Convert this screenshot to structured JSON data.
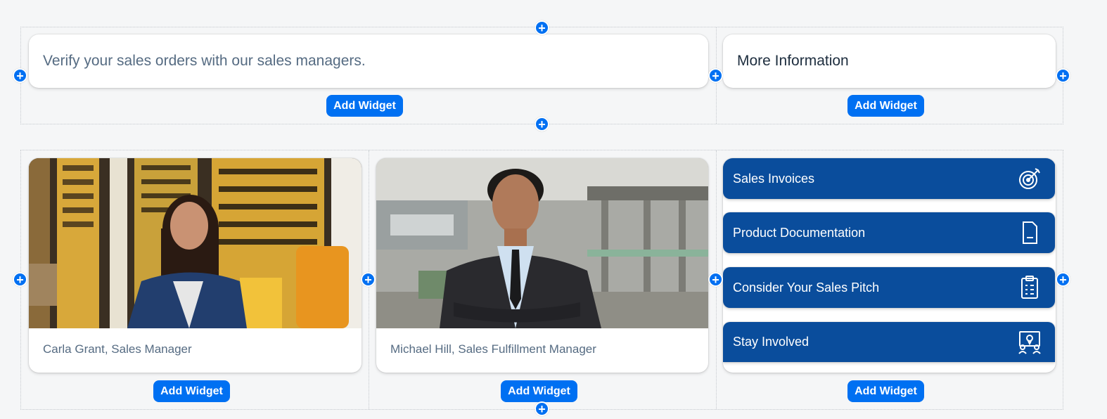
{
  "top_section": {
    "intro_text": "Verify your sales orders with our sales managers.",
    "more_info_title": "More Information"
  },
  "add_widget_label": "Add Widget",
  "plus_symbol": "+",
  "managers": [
    {
      "caption": "Carla Grant, Sales Manager"
    },
    {
      "caption": "Michael Hill, Sales Fulfillment Manager"
    }
  ],
  "links": [
    {
      "label": "Sales Invoices",
      "icon": "target-icon"
    },
    {
      "label": "Product Documentation",
      "icon": "document-icon"
    },
    {
      "label": "Consider Your Sales Pitch",
      "icon": "clipboard-icon"
    },
    {
      "label": "Stay Involved",
      "icon": "group-presentation-icon"
    }
  ],
  "colors": {
    "accent": "#0070f2",
    "tile": "#0a4d9c",
    "text_muted": "#556b82",
    "background": "#f5f6f7"
  }
}
